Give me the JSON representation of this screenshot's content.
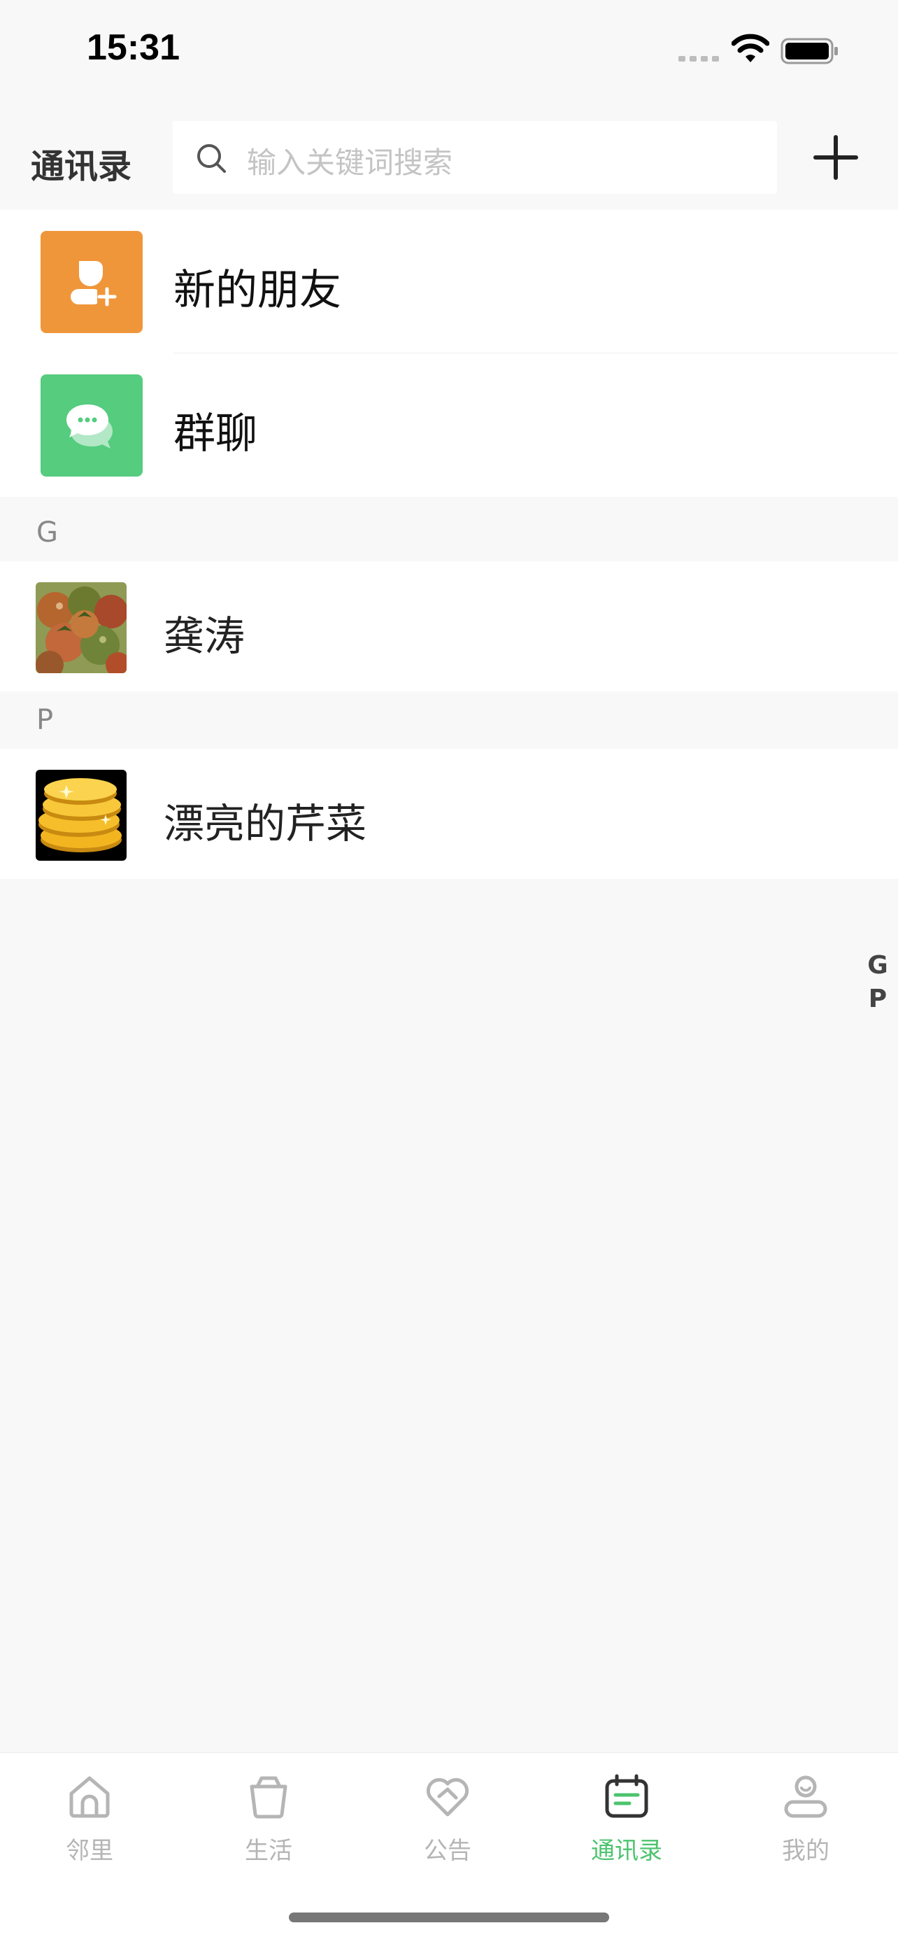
{
  "status_bar": {
    "time": "15:31"
  },
  "header": {
    "title": "通讯录",
    "search_placeholder": "输入关键词搜索",
    "add_icon": "plus-icon"
  },
  "entries": [
    {
      "label": "新的朋友",
      "icon": "add-friend-icon",
      "color": "#F0963A"
    },
    {
      "label": "群聊",
      "icon": "group-chat-icon",
      "color": "#55CC7E"
    }
  ],
  "sections": [
    {
      "letter": "G",
      "contacts": [
        {
          "name": "龚涛",
          "avatar": "tomatoes-photo"
        }
      ]
    },
    {
      "letter": "P",
      "contacts": [
        {
          "name": "漂亮的芹菜",
          "avatar": "gold-coins-photo"
        }
      ]
    }
  ],
  "index_bar": [
    "G",
    "P"
  ],
  "tab_bar": {
    "active_color": "#4CC46E",
    "inactive_color": "#B5B5B5",
    "tabs": [
      {
        "label": "邻里",
        "icon": "house-icon",
        "active": false
      },
      {
        "label": "生活",
        "icon": "shopping-bag-icon",
        "active": false
      },
      {
        "label": "公告",
        "icon": "heart-handshake-icon",
        "active": false
      },
      {
        "label": "通讯录",
        "icon": "calendar-list-icon",
        "active": true
      },
      {
        "label": "我的",
        "icon": "user-icon",
        "active": false
      }
    ]
  }
}
